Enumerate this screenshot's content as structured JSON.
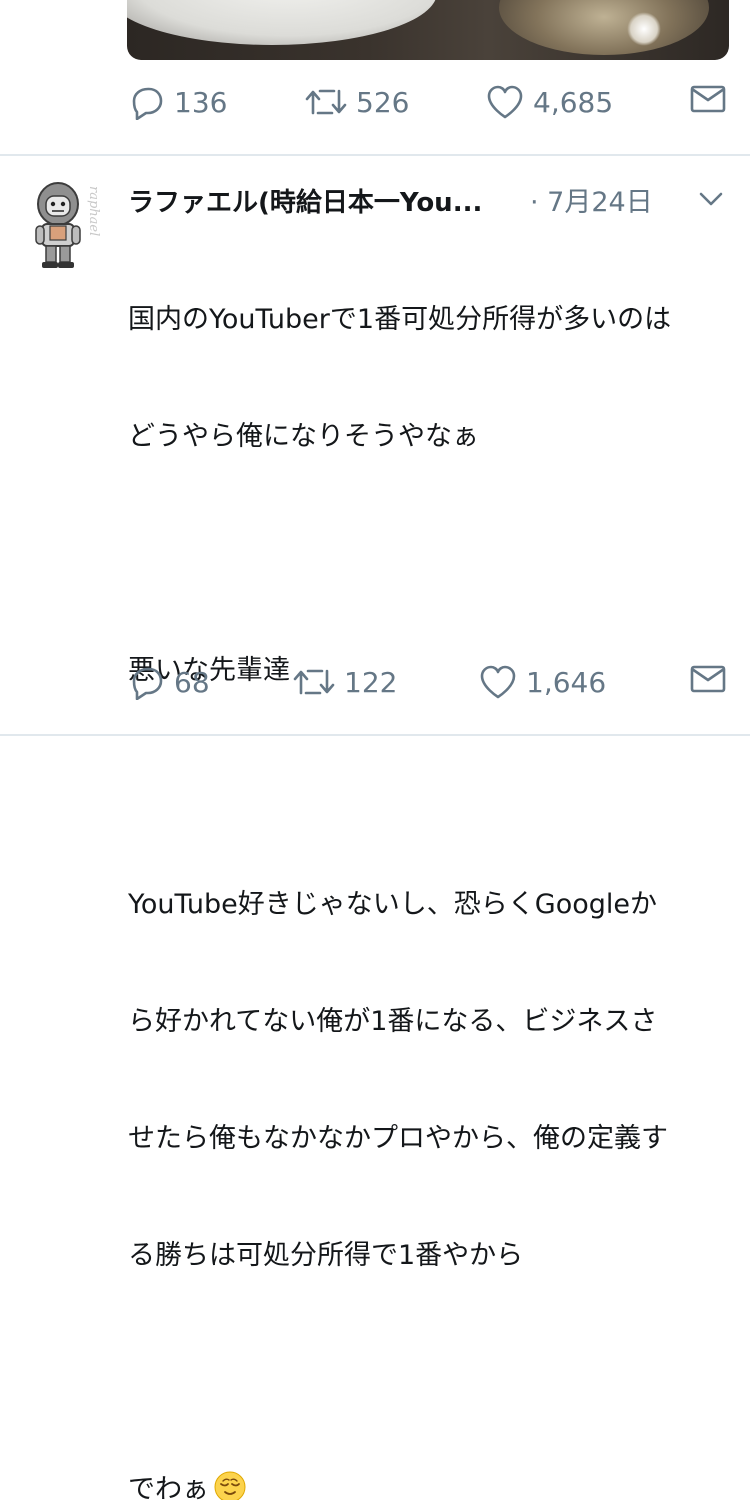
{
  "previous_tweet": {
    "actions": {
      "reply_count": "136",
      "retweet_count": "526",
      "like_count": "4,685"
    }
  },
  "tweet": {
    "author_name": "ラファエル(時給日本一You...",
    "date": "· 7月24日",
    "avatar_text": "raphael",
    "lines": [
      "国内のYouTuberで1番可処分所得が多いのは",
      "どうやら俺になりそうやなぁ",
      "",
      "悪いな先輩達",
      "",
      "YouTube好きじゃないし、恐らくGoogleか",
      "ら好かれてない俺が1番になる、ビジネスさ",
      "せたら俺もなかなかプロやから、俺の定義す",
      "る勝ちは可処分所得で1番やから",
      "",
      "でわぁ"
    ],
    "last_line_emoji": "relieved-face",
    "actions": {
      "reply_count": "68",
      "retweet_count": "122",
      "like_count": "1,646"
    }
  },
  "colors": {
    "text": "#14171a",
    "secondary": "#657786",
    "divider": "#e1e8ed",
    "background": "#ffffff"
  }
}
